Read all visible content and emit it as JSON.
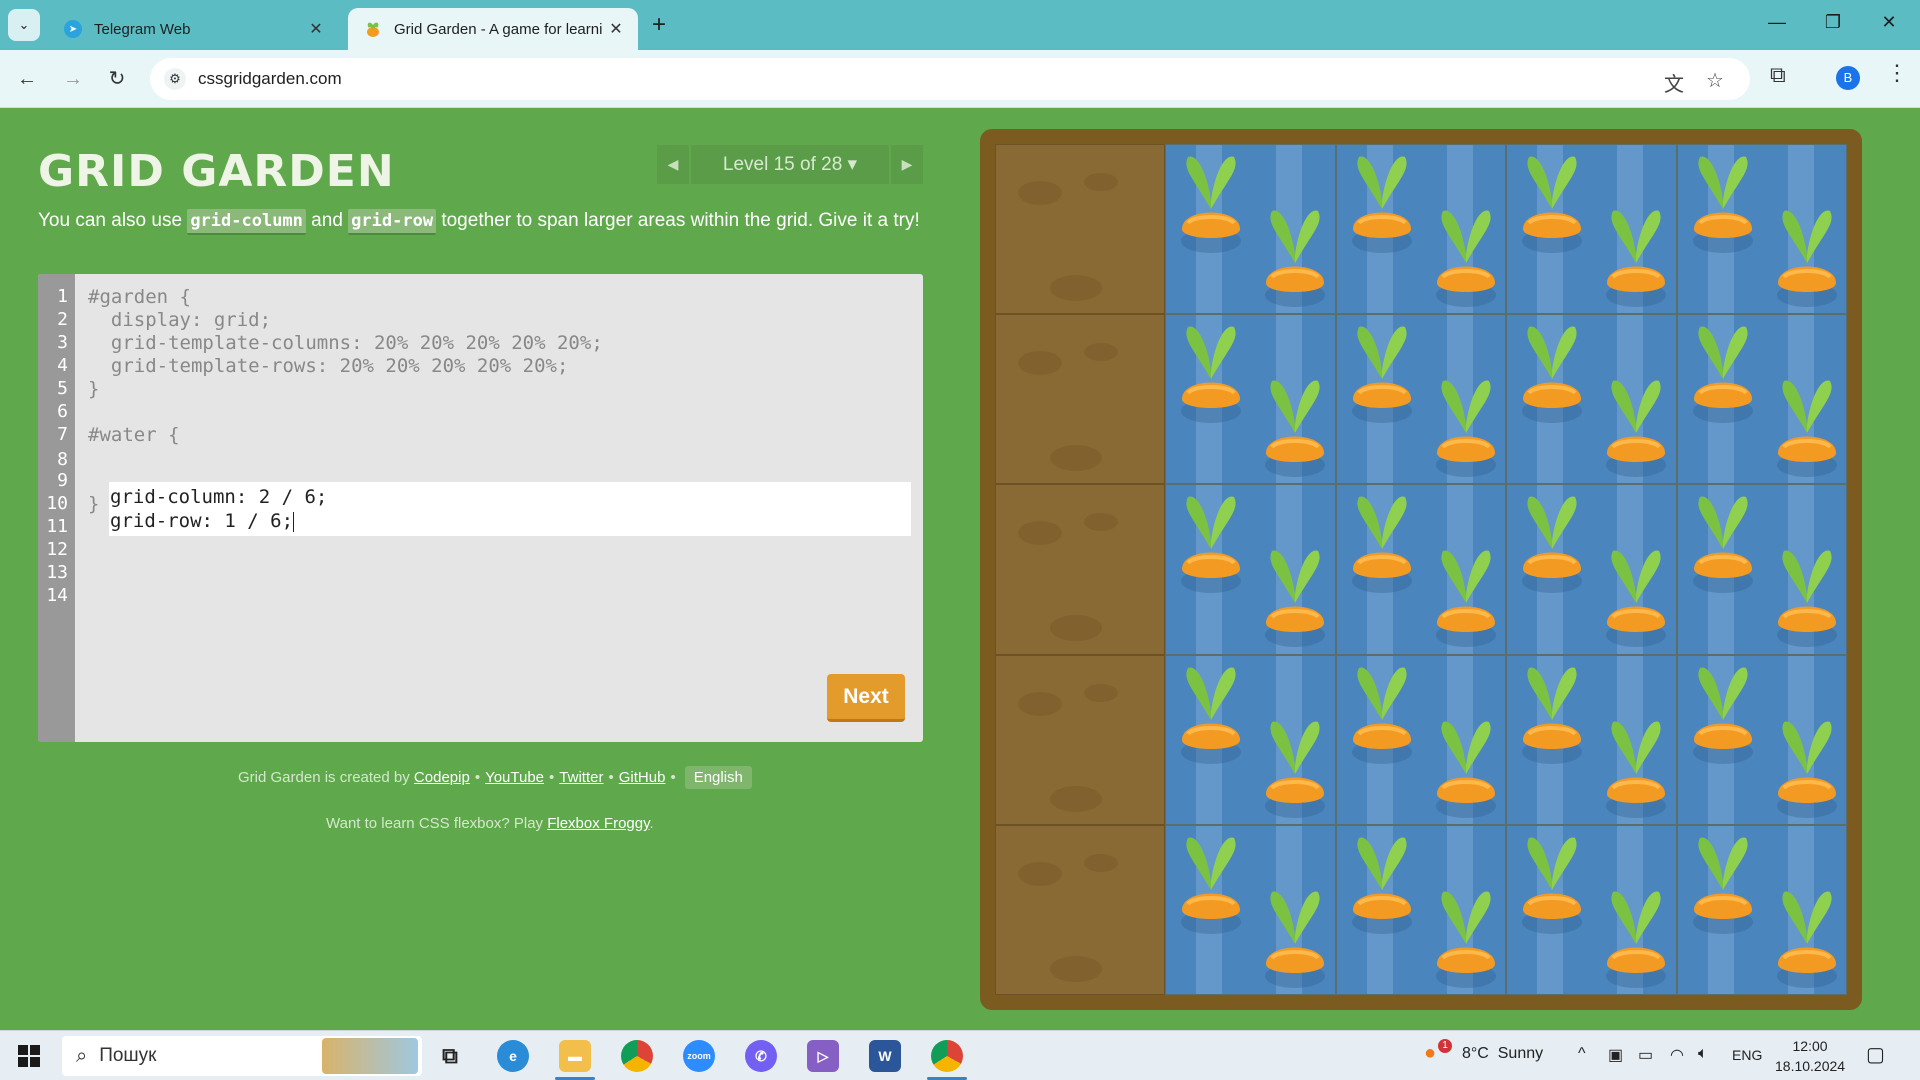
{
  "browser": {
    "tabs": [
      {
        "title": "Telegram Web",
        "active": false
      },
      {
        "title": "Grid Garden - A game for learni",
        "active": true
      }
    ],
    "url": "cssgridgarden.com",
    "profile_initial": "B"
  },
  "game": {
    "logo": "GRID GARDEN",
    "level_label": "Level 15 of 28 ▾",
    "instructions": {
      "before": "You can also use ",
      "code1": "grid-column",
      "middle": " and ",
      "code2": "grid-row",
      "after": " together to span larger areas within the grid. Give it a try!"
    },
    "editor": {
      "line_numbers": [
        "1",
        "2",
        "3",
        "4",
        "5",
        "6",
        "7",
        "8",
        "9",
        "10",
        "11",
        "12",
        "13",
        "14"
      ],
      "code_before": [
        "#garden {",
        "  display: grid;",
        "  grid-template-columns: 20% 20% 20% 20% 20%;",
        "  grid-template-rows: 20% 20% 20% 20% 20%;",
        "}",
        "",
        "#water {"
      ],
      "input_lines": [
        "grid-column: 2 / 6;",
        "grid-row: 1 / 6;"
      ],
      "code_after": [
        "}"
      ],
      "next_label": "Next"
    },
    "credits": {
      "prefix": "Grid Garden is created by",
      "links": [
        "Codepip",
        "YouTube",
        "Twitter",
        "GitHub"
      ],
      "language": "English"
    },
    "froggy": {
      "prefix": "Want to learn CSS flexbox? Play ",
      "link": "Flexbox Froggy",
      "suffix": "."
    },
    "garden": {
      "columns": 5,
      "rows": 5,
      "water_columns": [
        2,
        6
      ],
      "water_rows": [
        1,
        6
      ]
    }
  },
  "taskbar": {
    "search_placeholder": "Пошук",
    "weather": "8°C  Sunny",
    "weather_badge": "1",
    "lang": "ENG",
    "time": "12:00",
    "date": "18.10.2024"
  }
}
